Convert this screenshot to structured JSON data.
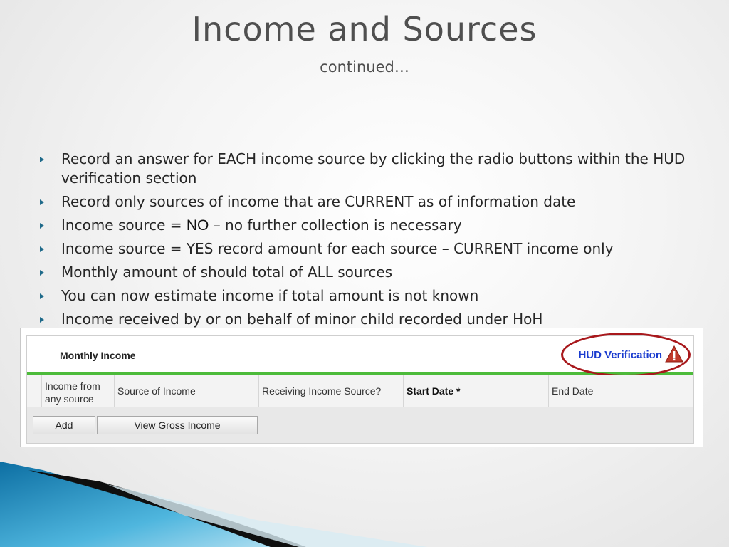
{
  "slide": {
    "title": "Income and Sources",
    "subtitle": "continued…"
  },
  "bullets": [
    {
      "text": "Record an answer for EACH income source by clicking the radio buttons within the HUD verification section"
    },
    {
      "text": "Record only sources of income that are CURRENT as of information date"
    },
    {
      "pre": "Income source = ",
      "emph": "NO",
      "post": " – no further collection is necessary"
    },
    {
      "text": "Income source = YES record amount for each source – CURRENT income only"
    },
    {
      "text": "Monthly amount of should total of ALL sources"
    },
    {
      "text": "You can now estimate income if total amount is not known"
    },
    {
      "text": "Income received by or on behalf of minor child recorded under HoH"
    }
  ],
  "form": {
    "panel_title": "Monthly Income",
    "hud_link": "HUD Verification",
    "columns": [
      {
        "label": "Income from any source"
      },
      {
        "label": "Source of Income"
      },
      {
        "label": "Receiving Income Source?"
      },
      {
        "label": "Start Date",
        "required_mark": "*"
      },
      {
        "label": "End Date"
      }
    ],
    "buttons": {
      "add": "Add",
      "view_gross": "View Gross Income"
    },
    "icons": {
      "warning": "warning-triangle-icon"
    },
    "colors": {
      "accent_bar": "#4cbb3a",
      "link": "#1a3ccf",
      "highlight_oval": "#a8181c",
      "warning": "#c0392b"
    }
  }
}
